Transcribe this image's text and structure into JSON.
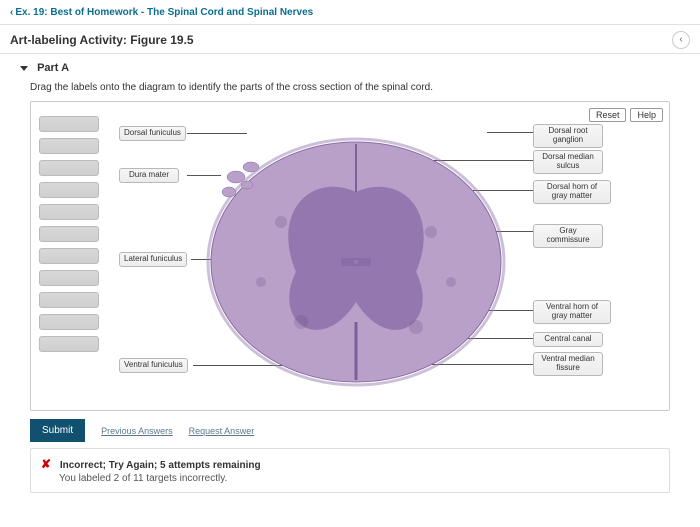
{
  "breadcrumb": "Ex. 19: Best of Homework - The Spinal Cord and Spinal Nerves",
  "page_title": "Art-labeling Activity: Figure 19.5",
  "part": {
    "label": "Part A"
  },
  "instructions": "Drag the labels onto the diagram to identify the parts of the cross section of the spinal cord.",
  "controls": {
    "reset": "Reset",
    "help": "Help"
  },
  "placed_labels": {
    "left": [
      {
        "text": "Dorsal funiculus"
      },
      {
        "text": "Dura mater"
      },
      {
        "text": "Lateral funiculus"
      },
      {
        "text": "Ventral funiculus"
      }
    ],
    "right": [
      {
        "text": "Dorsal root ganglion"
      },
      {
        "text": "Dorsal median sulcus"
      },
      {
        "text": "Dorsal horn of gray matter"
      },
      {
        "text": "Gray commissure"
      },
      {
        "text": "Ventral horn of gray matter"
      },
      {
        "text": "Central canal"
      },
      {
        "text": "Ventral median fissure"
      }
    ]
  },
  "empty_slots_count": 11,
  "submit": {
    "button": "Submit",
    "prev": "Previous Answers",
    "request": "Request Answer"
  },
  "feedback": {
    "status": "Incorrect; Try Again; 5 attempts remaining",
    "detail": "You labeled 2 of 11 targets incorrectly."
  },
  "colors": {
    "tissue": "#8a6aa6",
    "tissue_dark": "#6b4f87",
    "tissue_light": "#b8a0c9"
  }
}
